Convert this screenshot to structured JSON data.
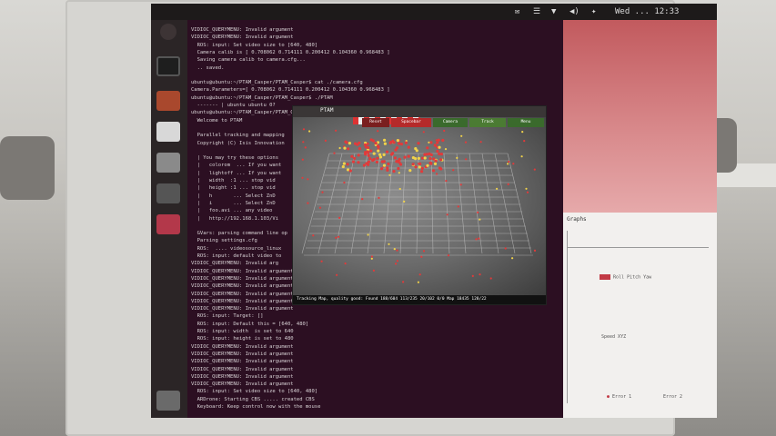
{
  "top_bar": {
    "indicators": [
      "✉",
      "☰",
      "▼",
      "◀)",
      "✦"
    ],
    "clock": "Wed ... 12:33"
  },
  "launcher": {
    "items": [
      "dash",
      "terminal",
      "files",
      "firefox",
      "settings",
      "camera",
      "ptam",
      "trash"
    ]
  },
  "terminal": {
    "lines": [
      "VIDIOC_QUERYMENU: Invalid argument",
      "VIDIOC_QUERYMENU: Invalid argument",
      "  ROS: input: Set video size to [640, 480]",
      "  Camera calib is [ 0.708062 0.714111 0.200412 0.104360 0.968483 ]",
      "  Saving camera calib to camera.cfg...",
      "  .. saved.",
      "",
      "ubuntu@ubuntu:~/PTAM_Casper/PTAM_Casper$ cat ./camera.cfg",
      "Camera.Parameters=[ 0.708062 0.714111 0.200412 0.104360 0.968483 ]",
      "ubuntu@ubuntu:~/PTAM_Casper/PTAM_Casper$ ./PTAM",
      "  ------- | ubuntu ubuntu 0?",
      "ubuntu@ubuntu:~/PTAM_Casper/PTAM_Casper$",
      "  Welcome to PTAM",
      "",
      "  Parallel tracking and mapping",
      "  Copyright (C) Isis Innovation",
      "",
      "  | You may try these options",
      "  |   colorom  ... If you want",
      "  |   lightoff ... If you want",
      "  |   width  :1 ... stop vid",
      "  |   height :1 ... stop vid",
      "  |   h       ... Select ZnD",
      "  |   i       ... Select ZnD",
      "  |   foo.avi ... any video",
      "  |   http://192.168.1.103/Vi",
      "",
      "  GVars: parsing command line op",
      "  Parsing settings.cfg",
      "  ROS:  .... videosource_linux",
      "  ROS: input: default video to",
      "VIDIOC_QUERYMENU: Invalid arg",
      "VIDIOC_QUERYMENU: Invalid argument",
      "VIDIOC_QUERYMENU: Invalid argument",
      "VIDIOC_QUERYMENU: Invalid argument",
      "VIDIOC_QUERYMENU: Invalid argument",
      "VIDIOC_QUERYMENU: Invalid argument",
      "VIDIOC_QUERYMENU: Invalid argument",
      "  ROS: input: Target: []",
      "  ROS: input: Default this = [640, 480]",
      "  ROS: input: width  is set to 640",
      "  ROS: input: height is set to 480",
      "VIDIOC_QUERYMENU: Invalid argument",
      "VIDIOC_QUERYMENU: Invalid argument",
      "VIDIOC_QUERYMENU: Invalid argument",
      "VIDIOC_QUERYMENU: Invalid argument",
      "VIDIOC_QUERYMENU: Invalid argument",
      "VIDIOC_QUERYMENU: Invalid argument",
      "  ROS: input: Set video size to [640, 480]",
      "  ARDrone: Starting CBS ..... created CBS",
      "  Keyboard: Keep control now with the mouse"
    ]
  },
  "ptam_window": {
    "title": "PTAM",
    "menu": [
      "Reset",
      "Spacebar",
      "Camera",
      "Track",
      "Menu"
    ],
    "status": "Tracking Map, quality good: Found 188/604 113/235 20/102 0/0 Map 18435 128/22"
  },
  "graph_window": {
    "title": "Graphs",
    "legend": [
      "Roll Pitch Yaw",
      "Speed XYZ",
      "Error 1",
      "Error 2"
    ]
  },
  "colors": {
    "terminal_bg": "#2c0f22",
    "accent_red": "#d33a3a",
    "menu_green": "#3a6a2c"
  }
}
